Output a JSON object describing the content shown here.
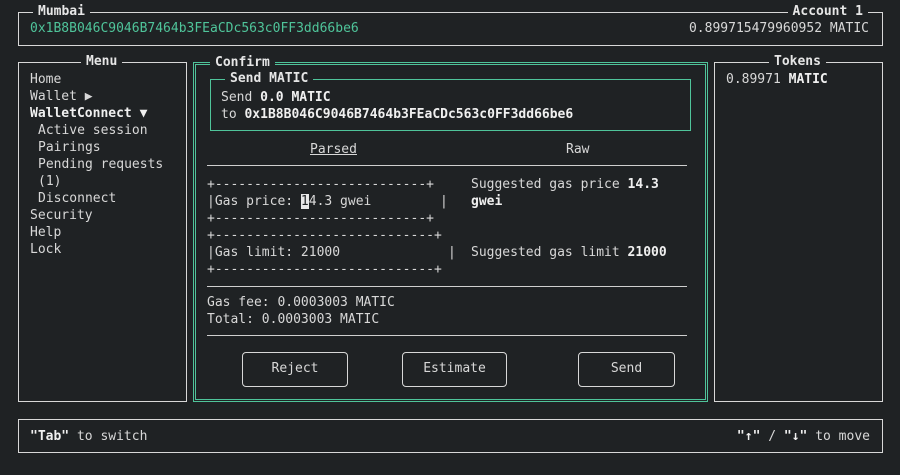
{
  "header": {
    "network": "Mumbai",
    "address": "0x1B8B046C9046B7464b3FEaCDc563c0FF3dd66be6",
    "account_label": "Account 1",
    "balance": "0.899715479960952 MATIC"
  },
  "menu": {
    "title": "Menu",
    "items": [
      "Home",
      "Wallet ▶",
      "WalletConnect ▼",
      "Active session",
      "Pairings",
      "Pending requests",
      "(1)",
      "Disconnect",
      "Security",
      "Help",
      "Lock"
    ]
  },
  "confirm": {
    "title": "Confirm",
    "send_box": {
      "title": "Send MATIC",
      "amount_prefix": "Send ",
      "amount": "0.0 MATIC",
      "to_prefix": "to ",
      "to_address": "0x1B8B046C9046B7464b3FEaCDc563c0FF3dd66be6"
    },
    "tabs": [
      "Parsed",
      "Raw"
    ],
    "gas_price": {
      "border_top": "+---------------------------+",
      "label": "|Gas price: ",
      "value_first_char": "1",
      "value_rest": "4.3 gwei",
      "right_border": "|",
      "border_bottom": "+---------------------------+",
      "suggested_prefix": "Suggested gas price ",
      "suggested_value_line1": "14.3",
      "suggested_value_line2": "gwei"
    },
    "gas_limit": {
      "border_top": "+----------------------------+",
      "text": "|Gas limit: 21000",
      "right_border": "|",
      "border_bottom": "+----------------------------+",
      "suggested_prefix": "Suggested gas limit ",
      "suggested_value": "21000"
    },
    "gas_fee": "Gas fee: 0.0003003 MATIC",
    "total": "Total: 0.0003003 MATIC",
    "buttons": {
      "reject": "Reject",
      "estimate": "Estimate",
      "send": "Send"
    }
  },
  "tokens": {
    "title": "Tokens",
    "balance_amount": "0.89971",
    "balance_symbol": "MATIC"
  },
  "footer": {
    "tab_key": "\"Tab\"",
    "tab_hint": " to switch",
    "up_key": "\"↑\"",
    "separator": " / ",
    "down_key": "\"↓\"",
    "move_hint": " to move"
  },
  "colors": {
    "background": "#1f2224",
    "accent_green": "#4fc49a",
    "text": "#d8d8d8"
  }
}
